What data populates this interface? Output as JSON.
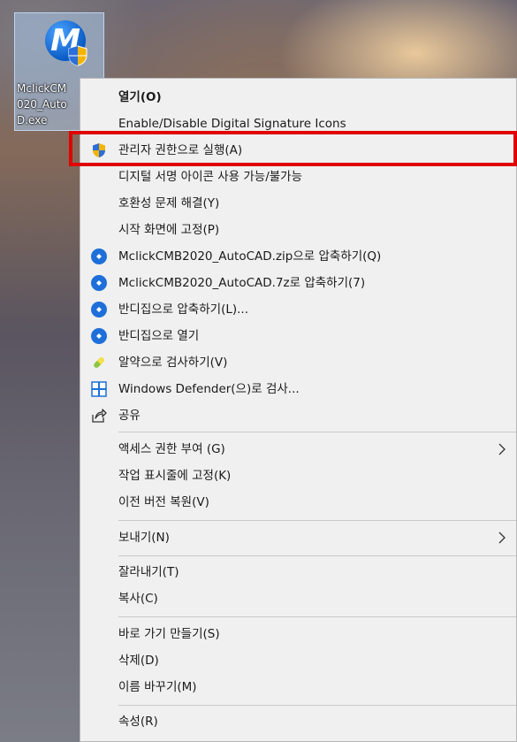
{
  "desktop": {
    "icon_label": "McIickCM\n020_Auto\nD.exe"
  },
  "menu": {
    "items": [
      {
        "label": "열기(O)",
        "icon": "none"
      },
      {
        "label": "Enable/Disable Digital Signature Icons",
        "icon": "none"
      },
      {
        "label": "관리자 권한으로 실행(A)",
        "icon": "uac-shield-icon"
      },
      {
        "label": "디지털 서명 아이콘 사용 가능/불가능",
        "icon": "none"
      },
      {
        "label": "호환성 문제 해결(Y)",
        "icon": "none"
      },
      {
        "label": "시작 화면에 고정(P)",
        "icon": "none"
      },
      {
        "label": "MclickCMB2020_AutoCAD.zip으로 압축하기(Q)",
        "icon": "bandizip-icon"
      },
      {
        "label": "MclickCMB2020_AutoCAD.7z로 압축하기(7)",
        "icon": "bandizip-icon"
      },
      {
        "label": "반디집으로 압축하기(L)...",
        "icon": "bandizip-icon"
      },
      {
        "label": "반디집으로 열기",
        "icon": "bandizip-icon"
      },
      {
        "label": "알약으로 검사하기(V)",
        "icon": "alyac-pill-icon"
      },
      {
        "label": "Windows Defender(으)로 검사...",
        "icon": "windows-defender-icon"
      },
      {
        "label": "공유",
        "icon": "share-icon"
      },
      {
        "label": "액세스 권한 부여 (G)",
        "icon": "none",
        "submenu": true
      },
      {
        "label": "작업 표시줄에 고정(K)",
        "icon": "none"
      },
      {
        "label": "이전 버전 복원(V)",
        "icon": "none"
      },
      {
        "label": "보내기(N)",
        "icon": "none",
        "submenu": true
      },
      {
        "label": "잘라내기(T)",
        "icon": "none"
      },
      {
        "label": "복사(C)",
        "icon": "none"
      },
      {
        "label": "바로 가기 만들기(S)",
        "icon": "none"
      },
      {
        "label": "삭제(D)",
        "icon": "none"
      },
      {
        "label": "이름 바꾸기(M)",
        "icon": "none"
      },
      {
        "label": "속성(R)",
        "icon": "none"
      }
    ]
  },
  "colors": {
    "highlight": "#e00000",
    "menu_bg": "#f0f0f0",
    "bandizip": "#1e6fd9"
  }
}
